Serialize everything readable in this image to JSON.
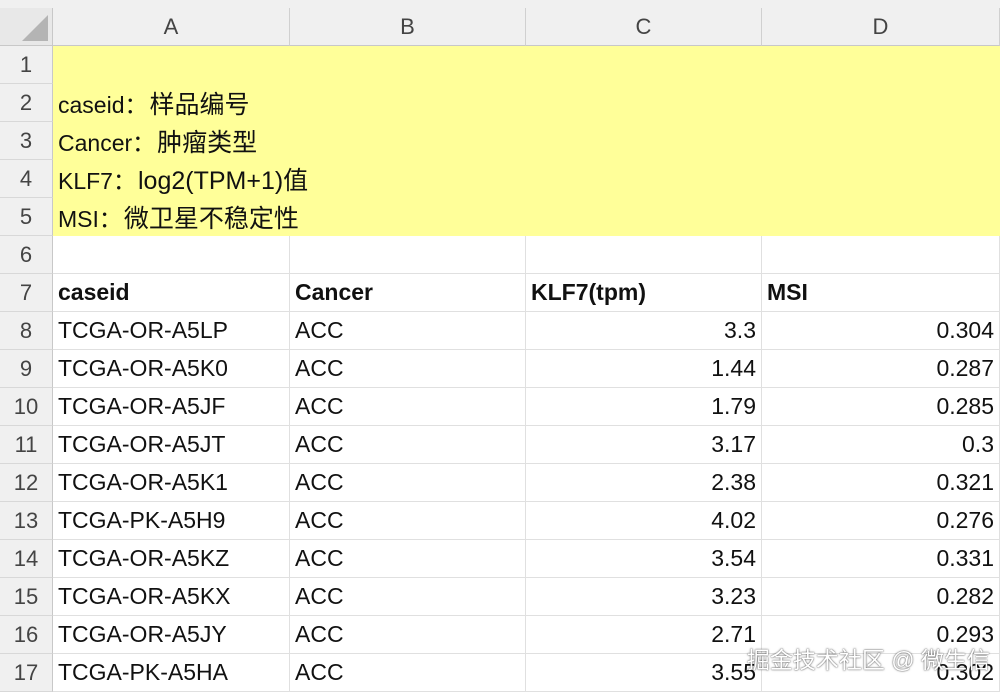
{
  "columns": [
    "A",
    "B",
    "C",
    "D"
  ],
  "rows": [
    "1",
    "2",
    "3",
    "4",
    "5",
    "6",
    "7",
    "8",
    "9",
    "10",
    "11",
    "12",
    "13",
    "14",
    "15",
    "16",
    "17"
  ],
  "notes": [
    {
      "key": "caseid：",
      "value": "样品编号"
    },
    {
      "key": "Cancer：",
      "value": "肿瘤类型"
    },
    {
      "key": "KLF7：",
      "value": "log2(TPM+1)值"
    },
    {
      "key": "MSI：",
      "value": "微卫星不稳定性"
    }
  ],
  "table": {
    "headers": [
      "caseid",
      "Cancer",
      "KLF7(tpm)",
      "MSI"
    ],
    "rows": [
      [
        "TCGA-OR-A5LP",
        "ACC",
        "3.3",
        "0.304"
      ],
      [
        "TCGA-OR-A5K0",
        "ACC",
        "1.44",
        "0.287"
      ],
      [
        "TCGA-OR-A5JF",
        "ACC",
        "1.79",
        "0.285"
      ],
      [
        "TCGA-OR-A5JT",
        "ACC",
        "3.17",
        "0.3"
      ],
      [
        "TCGA-OR-A5K1",
        "ACC",
        "2.38",
        "0.321"
      ],
      [
        "TCGA-PK-A5H9",
        "ACC",
        "4.02",
        "0.276"
      ],
      [
        "TCGA-OR-A5KZ",
        "ACC",
        "3.54",
        "0.331"
      ],
      [
        "TCGA-OR-A5KX",
        "ACC",
        "3.23",
        "0.282"
      ],
      [
        "TCGA-OR-A5JY",
        "ACC",
        "2.71",
        "0.293"
      ],
      [
        "TCGA-PK-A5HA",
        "ACC",
        "3.55",
        "0.302"
      ]
    ]
  },
  "watermark": "掘金技术社区 @ 微生信",
  "colors": {
    "note_fill": "#ffff99",
    "header_bg": "#f0f0f0",
    "gridline": "#e0e0e0"
  }
}
